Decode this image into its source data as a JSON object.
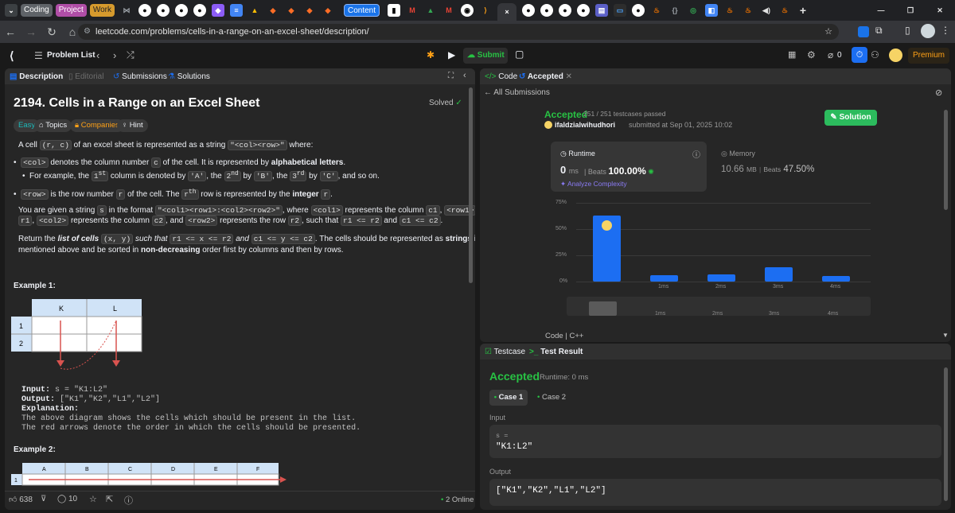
{
  "tabbar": {
    "groups": [
      {
        "label": "Coding",
        "color": "#5f6368"
      },
      {
        "label": "Project",
        "color": "#b04ea7"
      },
      {
        "label": "Work",
        "color": "#d69a2d"
      }
    ],
    "content_group": "Content",
    "new_tab": "+"
  },
  "address": {
    "url": "leetcode.com/problems/cells-in-a-range-on-an-excel-sheet/description/"
  },
  "lc": {
    "problem_list": "Problem List",
    "submit": "Submit",
    "streak": "0",
    "premium": "Premium"
  },
  "left": {
    "tabs": [
      "Description",
      "Editorial",
      "Submissions",
      "Solutions"
    ],
    "title": "2194. Cells in a Range on an Excel Sheet",
    "solved": "Solved",
    "chips": [
      "Easy",
      "Topics",
      "Companies",
      "Hint"
    ],
    "examples": {
      "ex1": "Example 1:",
      "ex2": "Example 2:"
    },
    "grid1": {
      "cols": [
        "K",
        "L"
      ],
      "rows": [
        "1",
        "2"
      ]
    },
    "grid2": {
      "cols": [
        "A",
        "B",
        "C",
        "D",
        "E",
        "F"
      ],
      "rows": [
        "1"
      ]
    },
    "io": {
      "input_label": "Input:",
      "input_val": "s = \"K1:L2\"",
      "output_label": "Output:",
      "output_val": "[\"K1\",\"K2\",\"L1\",\"L2\"]",
      "expl_label": "Explanation:",
      "expl1": "The above diagram shows the cells which should be present in the list.",
      "expl2": "The red arrows denote the order in which the cells should be presented."
    },
    "footer": {
      "likes": "638",
      "comments": "10",
      "online": "2 Online"
    }
  },
  "right": {
    "tabs": {
      "code": "Code",
      "accepted": "Accepted"
    },
    "all_submissions": "All Submissions",
    "status": "Accepted",
    "passed": "251 / 251 testcases passed",
    "user": "ifaldzialwihudhori",
    "submitted": "submitted at Sep 01, 2025 10:02",
    "solution_btn": "Solution",
    "runtime": {
      "label": "Runtime",
      "value": "0",
      "unit": "ms",
      "beats_label": "Beats",
      "beats": "100.00%",
      "analyze": "Analyze Complexity"
    },
    "memory": {
      "label": "Memory",
      "value": "10.66",
      "unit": "MB",
      "beats_label": "Beats",
      "beats": "47.50%"
    },
    "code_lang": "Code | C++"
  },
  "bottom": {
    "tabs": {
      "testcase": "Testcase",
      "result": "Test Result"
    },
    "status": "Accepted",
    "runtime": "Runtime: 0 ms",
    "cases": [
      "Case 1",
      "Case 2"
    ],
    "input_label": "Input",
    "var": "s =",
    "input_val": "\"K1:L2\"",
    "output_label": "Output",
    "output_val": "[\"K1\",\"K2\",\"L1\",\"L2\"]"
  },
  "chart_data": {
    "type": "bar",
    "x_unit": "ms",
    "categories": [
      "0ms",
      "1ms",
      "2ms",
      "3ms",
      "4ms"
    ],
    "values": [
      63,
      6,
      7,
      14,
      5
    ],
    "ylim": [
      0,
      75
    ],
    "yticks": [
      "0%",
      "25%",
      "50%",
      "75%"
    ],
    "xticks": [
      "1ms",
      "2ms",
      "3ms",
      "4ms"
    ],
    "bar_color": "#1c6ef2"
  }
}
